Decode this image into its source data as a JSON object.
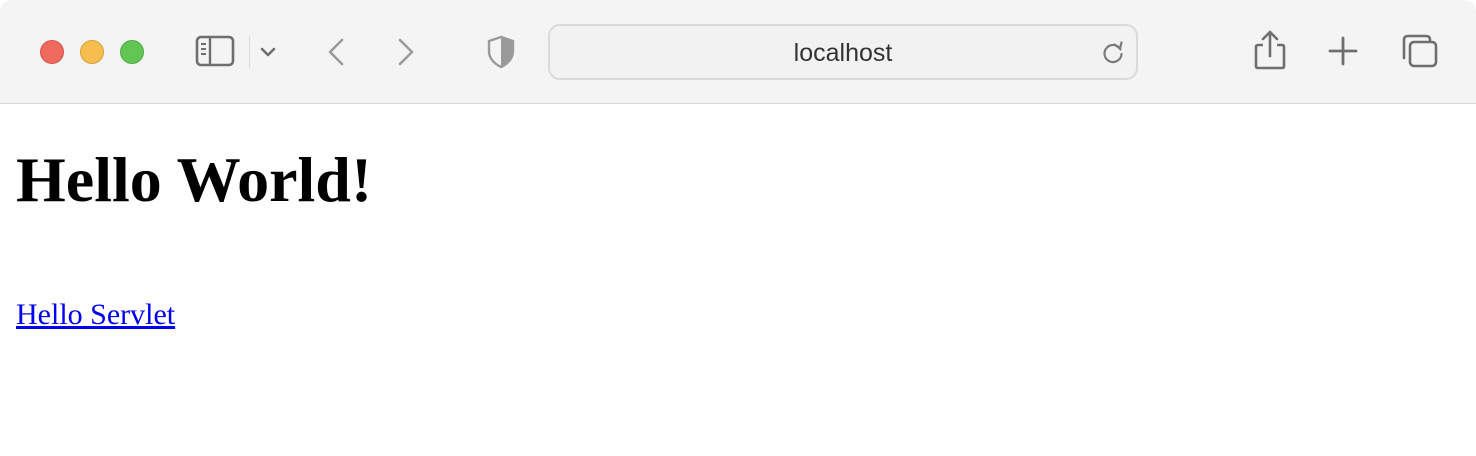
{
  "browser": {
    "address_bar": {
      "url_text": "localhost"
    },
    "colors": {
      "close": "#ee6a5f",
      "minimize": "#f5be4f",
      "zoom": "#62c655",
      "toolbar_background": "#f4f4f4"
    },
    "toolbar_icons": [
      "sidebar-icon",
      "chevron-down-icon",
      "back-arrow-icon",
      "forward-arrow-icon",
      "privacy-shield-icon",
      "reload-icon",
      "share-icon",
      "plus-icon",
      "tabs-overview-icon"
    ]
  },
  "page": {
    "heading": "Hello World!",
    "link_text": "Hello Servlet",
    "colors": {
      "text": "#000000",
      "link": "#0000ee",
      "background": "#ffffff"
    }
  }
}
